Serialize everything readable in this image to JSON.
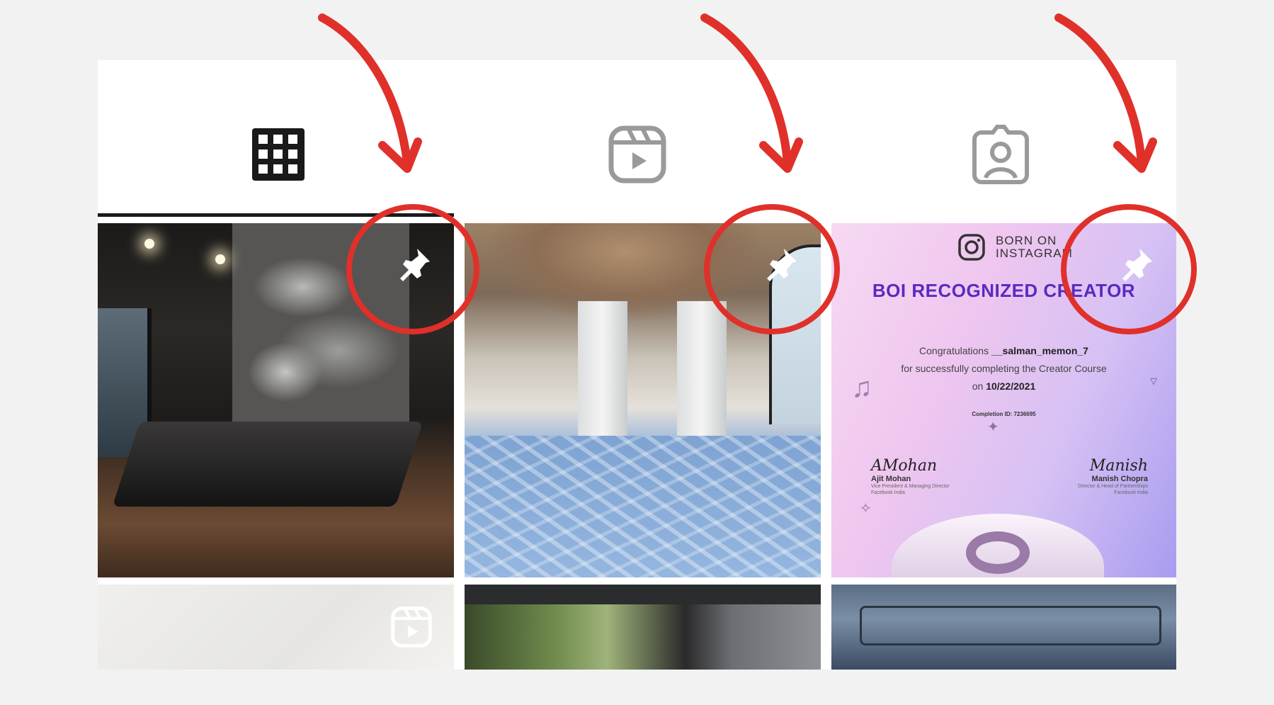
{
  "tabs": [
    {
      "name": "grid",
      "icon": "grid-icon",
      "active": true
    },
    {
      "name": "reels",
      "icon": "reels-icon",
      "active": false
    },
    {
      "name": "tagged",
      "icon": "tagged-icon",
      "active": false
    }
  ],
  "posts": [
    {
      "kind": "image",
      "pinned": true,
      "icon": "pin-icon"
    },
    {
      "kind": "image",
      "pinned": true,
      "icon": "pin-icon"
    },
    {
      "kind": "image",
      "pinned": true,
      "icon": "pin-icon"
    },
    {
      "kind": "reel",
      "pinned": false,
      "icon": "reels-icon"
    },
    {
      "kind": "image",
      "pinned": false
    },
    {
      "kind": "image",
      "pinned": false
    }
  ],
  "certificate": {
    "brand": "BORN ON\nINSTAGRAM",
    "title": "BOI RECOGNIZED CREATOR",
    "congrats": "Congratulations",
    "username": "__salman_memon_7",
    "line2": "for successfully completing the Creator Course",
    "on": "on",
    "date": "10/22/2021",
    "completion_id": "Completion ID: 7236695",
    "signer_left_scrawl": "AMohan",
    "signer_left_name": "Ajit Mohan",
    "signer_left_role": "Vice President & Managing Director\nFacebook India",
    "signer_right_scrawl": "Manish",
    "signer_right_name": "Manish Chopra",
    "signer_right_role": "Director & Head of Partnerships\nFacebook India"
  },
  "colors": {
    "annotation": "#e0302a",
    "background": "#f2f2f2",
    "icon_active": "#1a1a1a",
    "icon_inactive": "#9a9a9a",
    "certificate_title": "#5a2ac0"
  }
}
